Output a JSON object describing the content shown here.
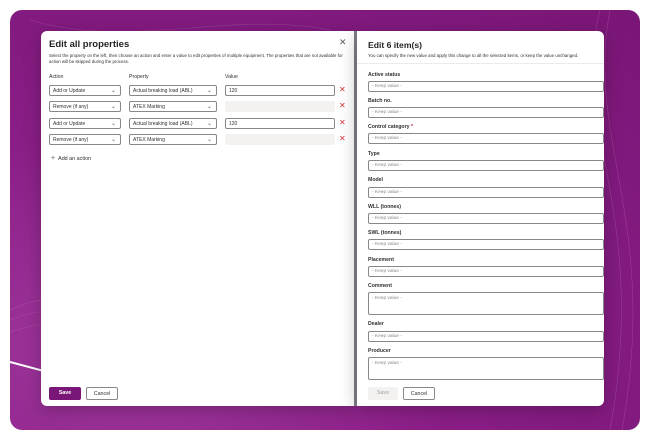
{
  "edit_all": {
    "title": "Edit all properties",
    "close_glyph": "✕",
    "description": "Select the property on the left, then choose an action and enter a value to edit properties of multiple equipment. The properties that are not available for action will be skipped during the process.",
    "headers": {
      "action": "Action",
      "property": "Property",
      "value": "Value"
    },
    "rows": [
      {
        "action": "Add or Update",
        "property": "Actual breaking load (ABL)",
        "value": "120",
        "value_enabled": true
      },
      {
        "action": "Remove (if any)",
        "property": "ATEX Marking",
        "value": "",
        "value_enabled": false
      },
      {
        "action": "Add or Update",
        "property": "Actual breaking load (ABL)",
        "value": "120",
        "value_enabled": true
      },
      {
        "action": "Remove (if any)",
        "property": "ATEX Marking",
        "value": "",
        "value_enabled": false
      }
    ],
    "add_action_label": "Add an action",
    "save_label": "Save",
    "cancel_label": "Cancel",
    "remove_glyph": "✕",
    "chevron_glyph": "⌄"
  },
  "edit_items": {
    "title": "Edit 6 item(s)",
    "description": "You can specify the new value and apply this change to all the selected items, or keep the value unchanged.",
    "fields": [
      {
        "label": "Active status",
        "placeholder": "- Keep value -",
        "required": false,
        "multiline": false
      },
      {
        "label": "Batch no.",
        "placeholder": "- Keep value -",
        "required": false,
        "multiline": false
      },
      {
        "label": "Control category",
        "placeholder": "- Keep value -",
        "required": true,
        "multiline": false
      },
      {
        "label": "Type",
        "placeholder": "- Keep value -",
        "required": false,
        "multiline": false
      },
      {
        "label": "Model",
        "placeholder": "- Keep value -",
        "required": false,
        "multiline": false
      },
      {
        "label": "WLL (tonnes)",
        "placeholder": "- Keep value -",
        "required": false,
        "multiline": false
      },
      {
        "label": "SWL (tonnes)",
        "placeholder": "- Keep value -",
        "required": false,
        "multiline": false
      },
      {
        "label": "Placement",
        "placeholder": "- Keep value -",
        "required": false,
        "multiline": false
      },
      {
        "label": "Comment",
        "placeholder": "- Keep value -",
        "required": false,
        "multiline": true
      },
      {
        "label": "Dealer",
        "placeholder": "- Keep value -",
        "required": false,
        "multiline": false
      },
      {
        "label": "Producer",
        "placeholder": "- Keep value -",
        "required": false,
        "multiline": true
      }
    ],
    "required_marker": "*",
    "save_label": "Save",
    "cancel_label": "Cancel"
  },
  "colors": {
    "brand": "#7a1677",
    "background": "#8a1e87",
    "danger": "#d13438"
  }
}
